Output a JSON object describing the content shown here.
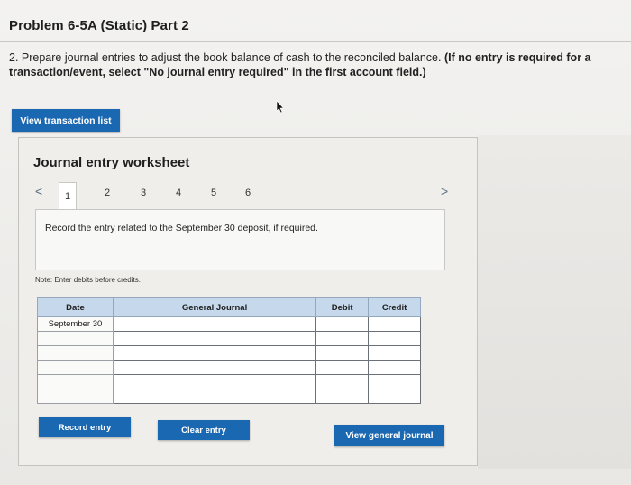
{
  "header": {
    "title": "Problem 6-5A (Static) Part 2"
  },
  "instruction": {
    "normal": "2. Prepare journal entries to adjust the book balance of cash to the reconciled balance. ",
    "bold": "(If no entry is required for a transaction/event, select \"No journal entry required\" in the first account field.)"
  },
  "buttons": {
    "view_transaction_list": "View transaction list",
    "record_entry": "Record entry",
    "clear_entry": "Clear entry",
    "view_general_journal": "View general journal"
  },
  "worksheet": {
    "title": "Journal entry worksheet",
    "pager": {
      "prev": "<",
      "next": ">",
      "pages": [
        "1",
        "2",
        "3",
        "4",
        "5",
        "6"
      ],
      "active": "1"
    },
    "entry_prompt": "Record the entry related to the September 30 deposit, if required.",
    "note": "Note: Enter debits before credits."
  },
  "journal": {
    "columns": [
      "Date",
      "General Journal",
      "Debit",
      "Credit"
    ],
    "rows": [
      {
        "date": "September 30",
        "account": "",
        "debit": "",
        "credit": ""
      },
      {
        "date": "",
        "account": "",
        "debit": "",
        "credit": ""
      },
      {
        "date": "",
        "account": "",
        "debit": "",
        "credit": ""
      },
      {
        "date": "",
        "account": "",
        "debit": "",
        "credit": ""
      },
      {
        "date": "",
        "account": "",
        "debit": "",
        "credit": ""
      },
      {
        "date": "",
        "account": "",
        "debit": "",
        "credit": ""
      }
    ]
  },
  "colors": {
    "button_blue": "#1b68b2",
    "header_blue": "#c6d9ec"
  }
}
